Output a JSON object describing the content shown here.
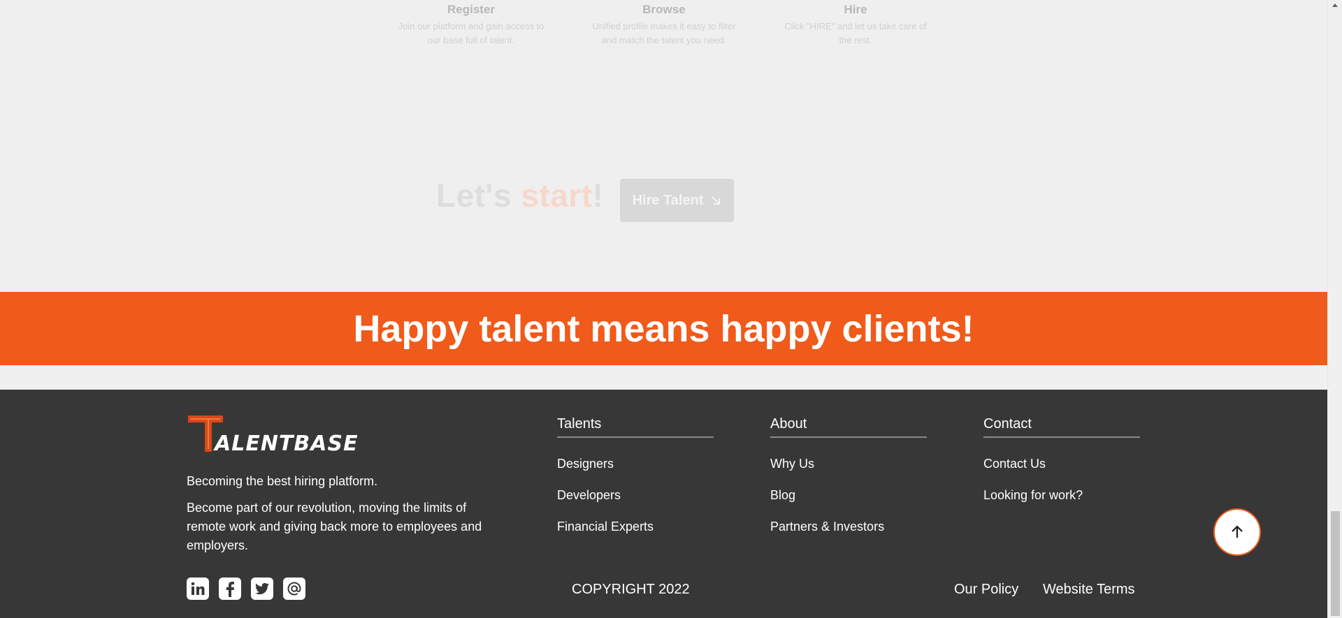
{
  "steps": [
    {
      "title": "Register",
      "desc_line1": "Join our platform and gain access to",
      "desc_line2": "our base full of talent."
    },
    {
      "title": "Browse",
      "desc_line1": "Unified profile makes it easy to filter",
      "desc_line2": "and match the talent you need."
    },
    {
      "title": "Hire",
      "desc_line1": "Click \"HIRE\" and let us take care of",
      "desc_line2": "the rest."
    }
  ],
  "cta": {
    "lets": "Let's ",
    "start": "start",
    "bang": "!",
    "button_label": "Hire Talent",
    "button_icon": "arrow-down-right-icon"
  },
  "banner": {
    "text": "Happy talent means happy clients!"
  },
  "footer": {
    "logo_text": "TALENTBASE",
    "tagline": "Becoming the best hiring platform.",
    "about": "Become part of our revolution, moving the limits of remote work and giving back more to employees and employers.",
    "columns": [
      {
        "title": "Talents",
        "links": [
          "Designers",
          "Developers",
          "Financial Experts"
        ]
      },
      {
        "title": "About",
        "links": [
          "Why Us",
          "Blog",
          "Partners & Investors"
        ]
      },
      {
        "title": "Contact",
        "links": [
          "Contact Us",
          "Looking for work?"
        ]
      }
    ],
    "socials": [
      "linkedin-icon",
      "facebook-icon",
      "twitter-icon",
      "at-sign-icon"
    ],
    "copyright": "COPYRIGHT 2022",
    "policy_label": "Our Policy",
    "terms_label": "Website Terms"
  },
  "colors": {
    "accent": "#f05a1a",
    "footer_bg": "#373737",
    "page_bg": "#f0f0f0"
  }
}
